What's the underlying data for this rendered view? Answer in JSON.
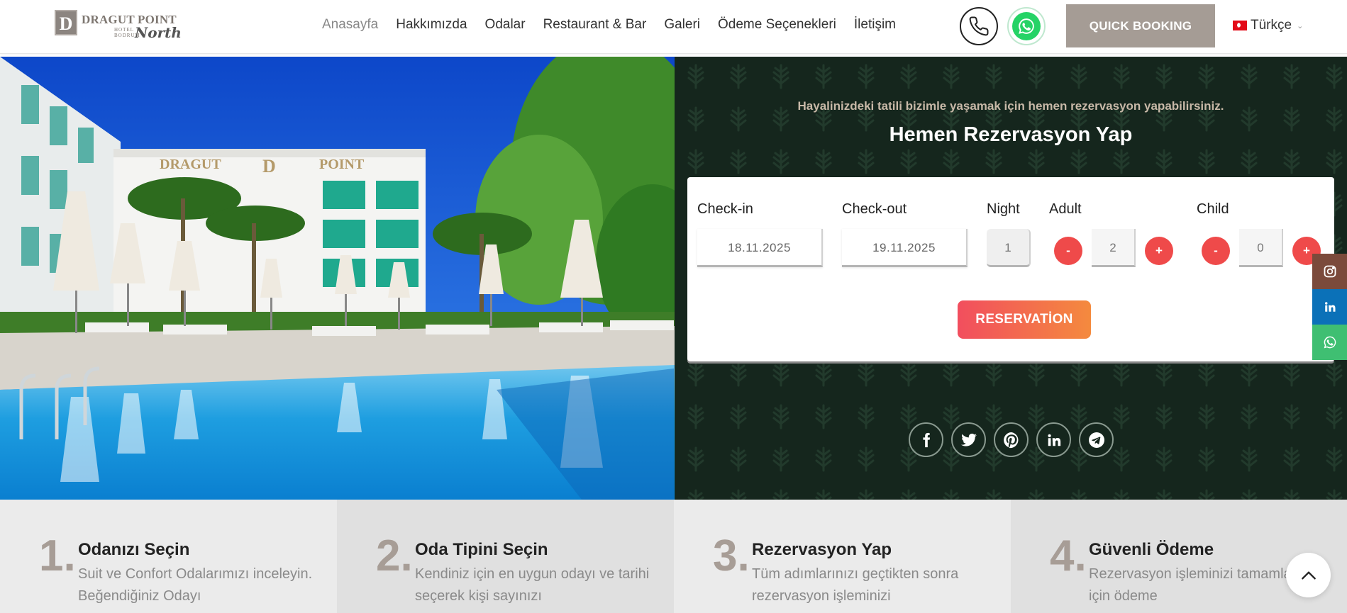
{
  "header": {
    "logo": {
      "mark": "D",
      "name": "DRAGUT POINT",
      "sub_hotel": "HOTEL",
      "sub_bodrum": "BODRUM",
      "script": "North"
    },
    "nav": [
      {
        "label": "Anasayfa",
        "active": true
      },
      {
        "label": "Hakkımızda"
      },
      {
        "label": "Odalar"
      },
      {
        "label": "Restaurant & Bar"
      },
      {
        "label": "Galeri"
      },
      {
        "label": "Ödeme Seçenekleri"
      },
      {
        "label": "İletişim"
      }
    ],
    "phone_icon": "phone-icon",
    "whatsapp_icon": "whatsapp-icon",
    "quick_booking": "QUICK BOOKING",
    "language": "Türkçe"
  },
  "booking": {
    "intro": "Hayalinizdeki tatili bizimle yaşamak için hemen rezervasyon yapabilirsiniz.",
    "title": "Hemen Rezervasyon Yap",
    "checkin_label": "Check-in",
    "checkin_value": "18.11.2025",
    "checkout_label": "Check-out",
    "checkout_value": "19.11.2025",
    "night_label": "Night",
    "night_value": "1",
    "adult_label": "Adult",
    "adult_value": "2",
    "child_label": "Child",
    "child_value": "0",
    "minus": "-",
    "plus": "+",
    "reservation_button": "RESERVATİON"
  },
  "steps": [
    {
      "num": "1.",
      "title": "Odanızı Seçin",
      "desc": "Suit ve Confort Odalarımızı inceleyin. Beğendiğiniz Odayı"
    },
    {
      "num": "2.",
      "title": "Oda Tipini Seçin",
      "desc": "Kendiniz için en uygun odayı ve tarihi seçerek kişi sayınızı"
    },
    {
      "num": "3.",
      "title": "Rezervasyon Yap",
      "desc": "Tüm adımlarınızı geçtikten sonra rezervasyon işleminizi"
    },
    {
      "num": "4.",
      "title": "Güvenli Ödeme",
      "desc": "Rezervasyon işleminizi tamamlamak için ödeme"
    }
  ],
  "colors": {
    "panel_bg": "#15261d",
    "quick_booking_bg": "#a59c95",
    "accent_red": "#ef4a4a",
    "reservation_gradient_start": "#f24e5e",
    "reservation_gradient_end": "#f48a3e"
  }
}
